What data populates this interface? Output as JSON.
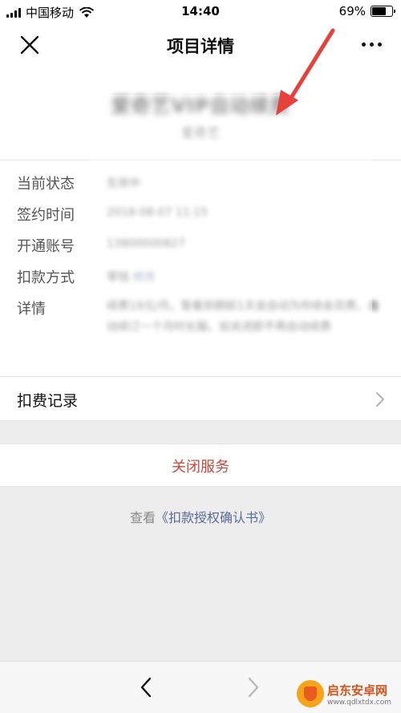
{
  "status_bar": {
    "carrier": "中国移动",
    "time": "14:40",
    "battery": "69%",
    "battery_level": 0.69
  },
  "nav": {
    "title": "项目详情"
  },
  "project": {
    "title": "爱奇艺VIP自动续费",
    "subtitle": "爱奇艺"
  },
  "details": {
    "rows": [
      {
        "label": "当前状态",
        "value": "生效中"
      },
      {
        "label": "签约时间",
        "value": "2018-08-07 11:15"
      },
      {
        "label": "开通账号",
        "value": "13800000827"
      },
      {
        "label": "扣款方式",
        "value": "零钱 ",
        "link": "修改"
      },
      {
        "label": "详情",
        "value": "续费19元/月。暂看到期前1天会自动为你续会员费，自动续订一个月时长服。如关闭即不再自动续费"
      }
    ]
  },
  "billing_record": {
    "label": "扣费记录"
  },
  "close_service": {
    "label": "关闭服务"
  },
  "auth": {
    "prefix": "查看",
    "link": "《扣款授权确认书》"
  },
  "watermark": {
    "name": "启东安卓网",
    "url": "www.qdlxtdx.com"
  },
  "colors": {
    "accent_red": "#c8483a",
    "link_blue": "#576b95",
    "arrow_red": "#e8403a"
  }
}
